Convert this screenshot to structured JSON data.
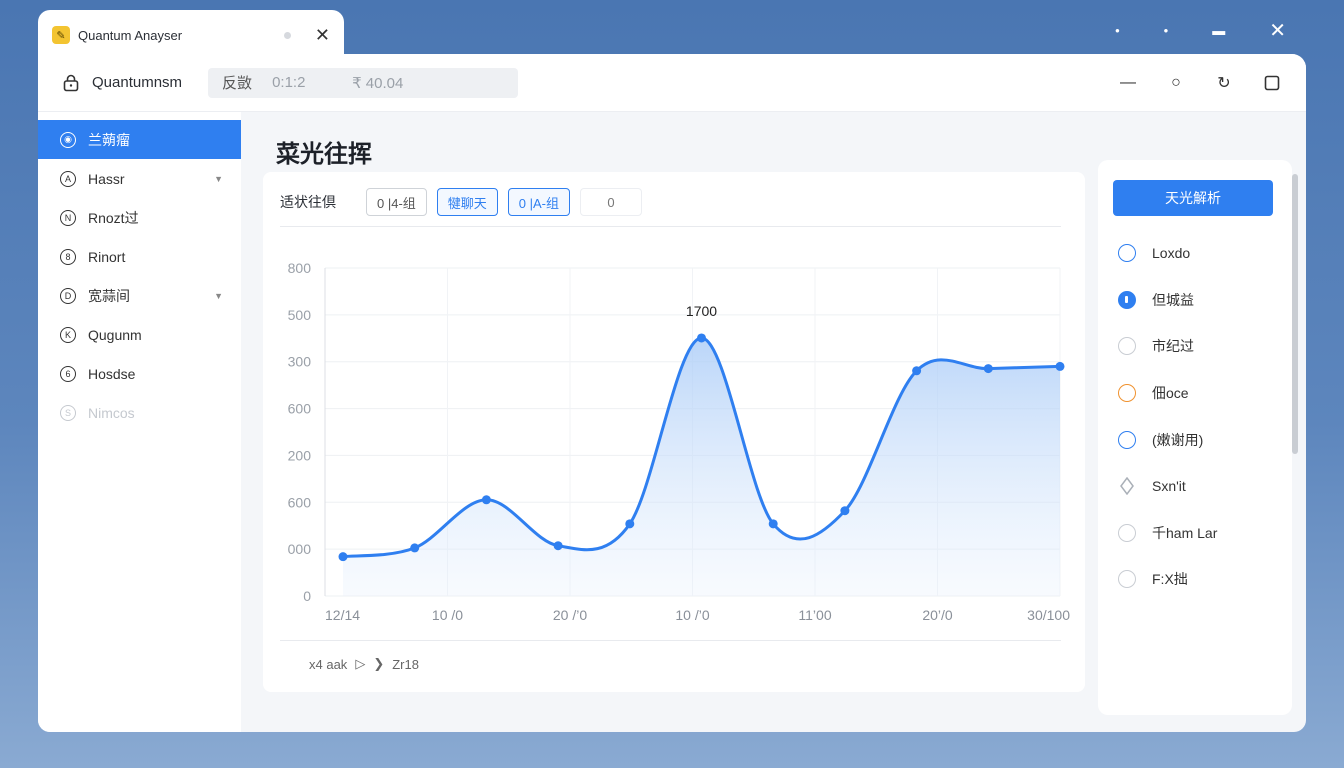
{
  "tab": {
    "title": "Quantum Anayser"
  },
  "toolbar": {
    "app_name": "Quantumnsm",
    "address": [
      "反敳",
      "0:1:2",
      "₹ 40.04"
    ]
  },
  "sidebar": {
    "items": [
      {
        "label": "兰蒴瘤",
        "active": true
      },
      {
        "label": "Hassr",
        "caret": true
      },
      {
        "label": "Rnozt过"
      },
      {
        "label": "Rinort"
      },
      {
        "label": "宽蒜间",
        "caret": true
      },
      {
        "label": "Qugunm"
      },
      {
        "label": "Hosdse"
      },
      {
        "label": "Nimcos",
        "dim": true
      }
    ]
  },
  "main": {
    "title": "菜光往挥",
    "filter_label": "适状往倶",
    "chips": [
      "0 |4-组",
      "犍聊天",
      "0 |A-组",
      "0"
    ]
  },
  "chart_data": {
    "type": "area",
    "annotation": "1700",
    "y_tick_labels": [
      "800",
      "500",
      "300",
      "600",
      "200",
      "600",
      "000",
      "0"
    ],
    "x_tick_labels": [
      "12/14",
      "10 /0",
      "20 /’0",
      "10 /’0",
      "11’00",
      "20’/0",
      "30/100"
    ],
    "values": [
      180,
      220,
      440,
      230,
      330,
      1180,
      330,
      390,
      1030,
      1040,
      1050
    ],
    "ylim": [
      0,
      1500
    ],
    "grid": true,
    "color": "#2f7ff0"
  },
  "footer": {
    "left": "x4 aak",
    "right": "Zr18"
  },
  "right_panel": {
    "button": "天光解析",
    "options": [
      {
        "label": "Loxdo",
        "style": "blue"
      },
      {
        "label": "但城益",
        "style": "filled"
      },
      {
        "label": "市纪过",
        "style": "plain"
      },
      {
        "label": "佃oce",
        "style": "orange"
      },
      {
        "label": "(嫩谢用)",
        "style": "blue"
      },
      {
        "label": "Sxn'it",
        "style": "diamond"
      },
      {
        "label": "千ham Lar",
        "style": "plain"
      },
      {
        "label": "F:X拙",
        "style": "plain"
      }
    ]
  }
}
